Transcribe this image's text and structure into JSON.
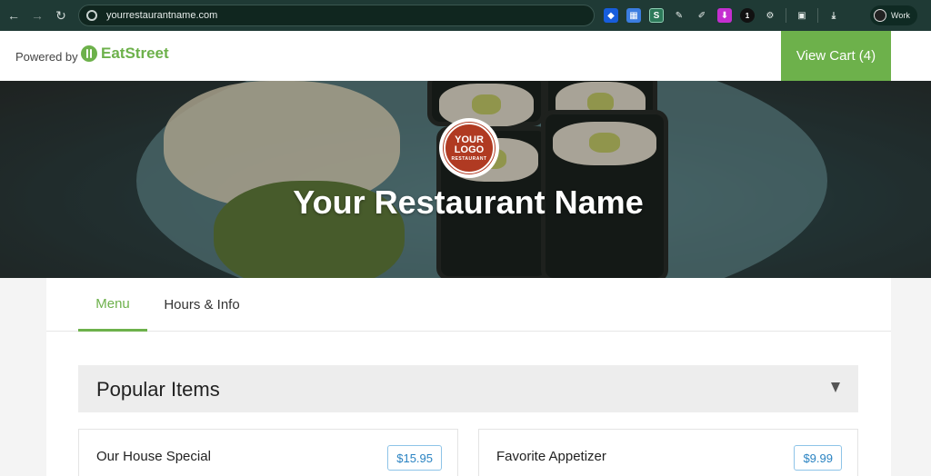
{
  "browser": {
    "url": "yourrestaurantname.com",
    "profile_label": "Work",
    "icons": [
      "back-icon",
      "forward-icon",
      "reload-icon",
      "site-info-icon"
    ],
    "extensions": [
      {
        "name": "bitwarden-icon",
        "color": "#175ddc",
        "glyph": "◆"
      },
      {
        "name": "calendar-ext-icon",
        "color": "#3b7de0",
        "glyph": "▦"
      },
      {
        "name": "s-ext-icon",
        "color": "#2d7a5a",
        "glyph": "S"
      },
      {
        "name": "eyedropper-icon",
        "color": "#1f3a35",
        "glyph": "✎"
      },
      {
        "name": "edit-ext-icon",
        "color": "#1f3a35",
        "glyph": "✐"
      },
      {
        "name": "download-ext-icon",
        "color": "#c42fd0",
        "glyph": "⬇"
      },
      {
        "name": "counter-ext-icon",
        "color": "#111111",
        "glyph": "1"
      },
      {
        "name": "puzzle-icon",
        "color": "#1f3a35",
        "glyph": "⚙"
      },
      {
        "name": "reading-mode-icon",
        "color": "#1f3a35",
        "glyph": "▣"
      },
      {
        "name": "downloads-icon",
        "color": "#1f3a35",
        "glyph": "⤓"
      }
    ]
  },
  "header": {
    "powered_by": "Powered by",
    "brand": "EatStreet",
    "cart_label": "View Cart (4)",
    "accent_color": "#6db14b"
  },
  "hero": {
    "logo_line1": "YOUR",
    "logo_line2": "LOGO",
    "logo_line3": "RESTAURANT",
    "restaurant_name": "Your Restaurant Name"
  },
  "tabs": [
    {
      "label": "Menu",
      "active": true
    },
    {
      "label": "Hours & Info",
      "active": false
    }
  ],
  "section": {
    "title": "Popular Items"
  },
  "items": [
    {
      "name": "Our House Special",
      "price": "$15.95"
    },
    {
      "name": "Favorite Appetizer",
      "price": "$9.99"
    }
  ]
}
